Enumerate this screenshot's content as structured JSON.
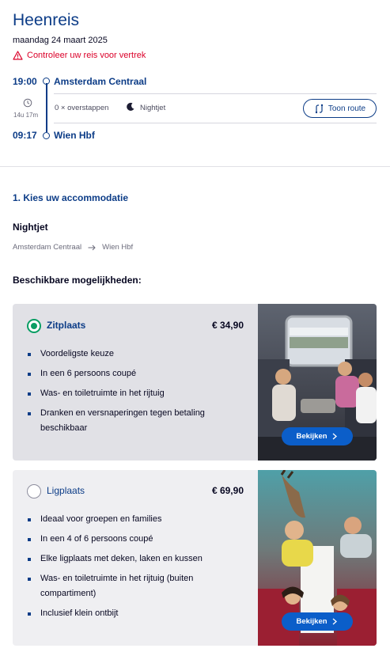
{
  "journey": {
    "title": "Heenreis",
    "date": "maandag 24 maart 2025",
    "warning": "Controleer uw reis voor vertrek",
    "departure_time": "19:00",
    "departure_station": "Amsterdam Centraal",
    "duration": "14u 17m",
    "transfers": "0 × overstappen",
    "train_type": "Nightjet",
    "route_button": "Toon route",
    "arrival_time": "09:17",
    "arrival_station": "Wien Hbf"
  },
  "accommodation": {
    "step_title": "1. Kies uw accommodatie",
    "train_name": "Nightjet",
    "from": "Amsterdam Centraal",
    "to": "Wien Hbf",
    "available_label": "Beschikbare mogelijkheden:",
    "options": [
      {
        "name": "Zitplaats",
        "price": "€ 34,90",
        "selected": true,
        "features": [
          "Voordeligste keuze",
          "In een 6 persoons coupé",
          "Was- en toiletruimte in het rijtuig",
          "Dranken en versnaperingen tegen betaling beschikbaar"
        ],
        "view_button": "Bekijken"
      },
      {
        "name": "Ligplaats",
        "price": "€ 69,90",
        "selected": false,
        "features": [
          "Ideaal voor groepen en families",
          "In een 4 of 6 persoons coupé",
          "Elke ligplaats met deken, laken en kussen",
          "Was- en toiletruimte in het rijtuig (buiten compartiment)",
          "Inclusief klein ontbijt"
        ],
        "view_button": "Bekijken"
      }
    ]
  },
  "colors": {
    "brand_blue": "#0c3c87",
    "warning_red": "#db0029",
    "selected_green": "#0a9e64",
    "button_blue": "#0b5ec9"
  },
  "icons": [
    "warning-icon",
    "clock-icon",
    "moon-icon",
    "route-icon",
    "arrow-right-icon",
    "chevron-right-icon"
  ]
}
